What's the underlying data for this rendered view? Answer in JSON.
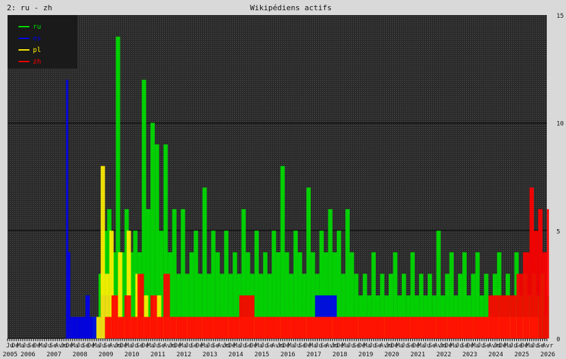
{
  "header": {
    "left_label": "2: ru - zh",
    "title": "Wikipédiens actifs"
  },
  "chart_data": {
    "type": "line",
    "title": "Wikipédiens actifs",
    "y_ticks": [
      "0",
      "5",
      "10",
      "15"
    ],
    "ylim": [
      0,
      15
    ],
    "x_years": [
      "2005",
      "2006",
      "2007",
      "2008",
      "2009",
      "2010",
      "2011",
      "2012",
      "2013",
      "2014",
      "2015",
      "2016",
      "2017",
      "2018",
      "2019",
      "2020",
      "2021",
      "2022",
      "2023",
      "2024",
      "2025",
      "2026"
    ],
    "xlim": [
      "2005-07",
      "2026-04"
    ],
    "x_month_ticks_sample": [
      "Ju",
      "Dé",
      "Ma",
      "Ju",
      "Se",
      "Dé",
      "Ma",
      "Ju",
      "Se",
      "Avr"
    ],
    "legend_position": "top-left",
    "series": [
      {
        "name": "ru",
        "color": "#00dd00",
        "points": [
          [
            "2008-10",
            1
          ],
          [
            "2009-01",
            3
          ],
          [
            "2009-03",
            5
          ],
          [
            "2009-05",
            6
          ],
          [
            "2009-07",
            4
          ],
          [
            "2009-09",
            14
          ],
          [
            "2009-11",
            4
          ],
          [
            "2010-01",
            6
          ],
          [
            "2010-03",
            4
          ],
          [
            "2010-05",
            5
          ],
          [
            "2010-07",
            4
          ],
          [
            "2010-09",
            12
          ],
          [
            "2010-11",
            6
          ],
          [
            "2011-01",
            10
          ],
          [
            "2011-03",
            9
          ],
          [
            "2011-05",
            5
          ],
          [
            "2011-07",
            9
          ],
          [
            "2011-09",
            4
          ],
          [
            "2011-11",
            6
          ],
          [
            "2012-01",
            3
          ],
          [
            "2012-03",
            6
          ],
          [
            "2012-05",
            3
          ],
          [
            "2012-07",
            4
          ],
          [
            "2012-09",
            5
          ],
          [
            "2012-11",
            3
          ],
          [
            "2013-01",
            7
          ],
          [
            "2013-03",
            3
          ],
          [
            "2013-05",
            5
          ],
          [
            "2013-07",
            4
          ],
          [
            "2013-09",
            3
          ],
          [
            "2013-11",
            5
          ],
          [
            "2014-01",
            3
          ],
          [
            "2014-03",
            4
          ],
          [
            "2014-05",
            3
          ],
          [
            "2014-07",
            6
          ],
          [
            "2014-09",
            4
          ],
          [
            "2014-11",
            3
          ],
          [
            "2015-01",
            5
          ],
          [
            "2015-03",
            3
          ],
          [
            "2015-05",
            4
          ],
          [
            "2015-07",
            3
          ],
          [
            "2015-09",
            5
          ],
          [
            "2015-11",
            4
          ],
          [
            "2016-01",
            8
          ],
          [
            "2016-03",
            4
          ],
          [
            "2016-05",
            3
          ],
          [
            "2016-07",
            5
          ],
          [
            "2016-09",
            4
          ],
          [
            "2016-11",
            3
          ],
          [
            "2017-01",
            7
          ],
          [
            "2017-03",
            4
          ],
          [
            "2017-05",
            3
          ],
          [
            "2017-07",
            5
          ],
          [
            "2017-09",
            4
          ],
          [
            "2017-11",
            6
          ],
          [
            "2018-01",
            4
          ],
          [
            "2018-03",
            5
          ],
          [
            "2018-05",
            3
          ],
          [
            "2018-07",
            6
          ],
          [
            "2018-09",
            4
          ],
          [
            "2018-11",
            3
          ],
          [
            "2019-01",
            2
          ],
          [
            "2019-03",
            3
          ],
          [
            "2019-05",
            2
          ],
          [
            "2019-07",
            4
          ],
          [
            "2019-09",
            2
          ],
          [
            "2019-11",
            3
          ],
          [
            "2020-01",
            2
          ],
          [
            "2020-03",
            3
          ],
          [
            "2020-05",
            4
          ],
          [
            "2020-07",
            2
          ],
          [
            "2020-09",
            3
          ],
          [
            "2020-11",
            2
          ],
          [
            "2021-01",
            4
          ],
          [
            "2021-03",
            2
          ],
          [
            "2021-05",
            3
          ],
          [
            "2021-07",
            2
          ],
          [
            "2021-09",
            3
          ],
          [
            "2021-11",
            2
          ],
          [
            "2022-01",
            5
          ],
          [
            "2022-03",
            2
          ],
          [
            "2022-05",
            3
          ],
          [
            "2022-07",
            4
          ],
          [
            "2022-09",
            2
          ],
          [
            "2022-11",
            3
          ],
          [
            "2023-01",
            4
          ],
          [
            "2023-03",
            2
          ],
          [
            "2023-05",
            3
          ],
          [
            "2023-07",
            4
          ],
          [
            "2023-09",
            2
          ],
          [
            "2023-11",
            3
          ],
          [
            "2024-01",
            2
          ],
          [
            "2024-03",
            3
          ],
          [
            "2024-05",
            4
          ],
          [
            "2024-07",
            2
          ],
          [
            "2024-09",
            3
          ],
          [
            "2024-11",
            2
          ],
          [
            "2025-01",
            4
          ],
          [
            "2025-03",
            2
          ],
          [
            "2025-05",
            3
          ],
          [
            "2025-07",
            2
          ],
          [
            "2025-09",
            3
          ],
          [
            "2025-11",
            2
          ],
          [
            "2026-01",
            3
          ],
          [
            "2026-03",
            1
          ],
          [
            "2026-04",
            2
          ]
        ]
      },
      {
        "name": "es",
        "color": "#0000ee",
        "points": [
          [
            "2007-09",
            0
          ],
          [
            "2007-10",
            12
          ],
          [
            "2007-11",
            4
          ],
          [
            "2007-12",
            1
          ],
          [
            "2008-01",
            1
          ],
          [
            "2008-03",
            1
          ],
          [
            "2008-05",
            1
          ],
          [
            "2008-07",
            2
          ],
          [
            "2008-09",
            1
          ],
          [
            "2008-11",
            1
          ],
          [
            "2009-02",
            2
          ],
          [
            "2009-06",
            1
          ],
          [
            "2010-01",
            1
          ],
          [
            "2010-06",
            1
          ],
          [
            "2011-02",
            1
          ],
          [
            "2012-06",
            1
          ],
          [
            "2013-09",
            1
          ],
          [
            "2015-05",
            1
          ],
          [
            "2017-05",
            2
          ],
          [
            "2018-03",
            1
          ],
          [
            "2020-02",
            1
          ],
          [
            "2022-04",
            1
          ],
          [
            "2024-05",
            1
          ],
          [
            "2025-08",
            1
          ]
        ]
      },
      {
        "name": "pl",
        "color": "#ffee00",
        "points": [
          [
            "2008-12",
            1
          ],
          [
            "2009-02",
            8
          ],
          [
            "2009-04",
            3
          ],
          [
            "2009-06",
            5
          ],
          [
            "2009-08",
            2
          ],
          [
            "2009-10",
            4
          ],
          [
            "2009-12",
            1
          ],
          [
            "2010-02",
            5
          ],
          [
            "2010-04",
            1
          ],
          [
            "2010-06",
            3
          ],
          [
            "2010-08",
            1
          ],
          [
            "2010-10",
            2
          ],
          [
            "2010-12",
            1
          ],
          [
            "2011-02",
            2
          ],
          [
            "2011-06",
            1
          ],
          [
            "2011-10",
            1
          ],
          [
            "2012-03",
            1
          ],
          [
            "2012-09",
            1
          ],
          [
            "2013-05",
            1
          ],
          [
            "2014-06",
            1
          ],
          [
            "2015-10",
            1
          ],
          [
            "2016-08",
            1
          ],
          [
            "2017-06",
            1
          ],
          [
            "2018-04",
            1
          ],
          [
            "2019-10",
            1
          ],
          [
            "2021-08",
            1
          ],
          [
            "2024-02",
            1
          ],
          [
            "2025-11",
            1
          ]
        ]
      },
      {
        "name": "zh",
        "color": "#ff0000",
        "points": [
          [
            "2009-04",
            1
          ],
          [
            "2009-07",
            2
          ],
          [
            "2009-10",
            1
          ],
          [
            "2010-01",
            2
          ],
          [
            "2010-04",
            1
          ],
          [
            "2010-07",
            3
          ],
          [
            "2010-10",
            1
          ],
          [
            "2011-01",
            2
          ],
          [
            "2011-04",
            1
          ],
          [
            "2011-07",
            3
          ],
          [
            "2011-10",
            1
          ],
          [
            "2012-01",
            1
          ],
          [
            "2012-06",
            1
          ],
          [
            "2013-01",
            1
          ],
          [
            "2013-06",
            1
          ],
          [
            "2014-01",
            1
          ],
          [
            "2014-06",
            2
          ],
          [
            "2015-01",
            1
          ],
          [
            "2015-06",
            1
          ],
          [
            "2016-01",
            1
          ],
          [
            "2016-06",
            1
          ],
          [
            "2017-01",
            1
          ],
          [
            "2017-06",
            1
          ],
          [
            "2018-01",
            1
          ],
          [
            "2018-06",
            1
          ],
          [
            "2019-01",
            1
          ],
          [
            "2019-06",
            1
          ],
          [
            "2020-01",
            1
          ],
          [
            "2020-06",
            1
          ],
          [
            "2021-01",
            1
          ],
          [
            "2021-06",
            1
          ],
          [
            "2022-01",
            1
          ],
          [
            "2022-06",
            1
          ],
          [
            "2023-01",
            1
          ],
          [
            "2023-06",
            1
          ],
          [
            "2024-01",
            2
          ],
          [
            "2024-06",
            2
          ],
          [
            "2024-11",
            2
          ],
          [
            "2025-02",
            3
          ],
          [
            "2025-05",
            4
          ],
          [
            "2025-08",
            7
          ],
          [
            "2025-10",
            5
          ],
          [
            "2025-12",
            6
          ],
          [
            "2026-02",
            4
          ],
          [
            "2026-04",
            6
          ]
        ]
      }
    ]
  }
}
